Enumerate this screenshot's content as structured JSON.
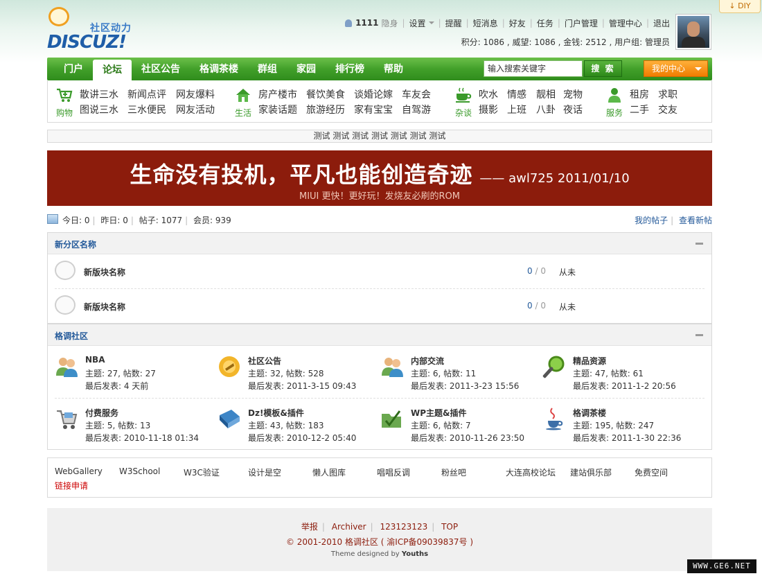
{
  "diy_label": "↓ DIY",
  "logo": {
    "sub": "社区动力",
    "main": "DISCUZ!"
  },
  "user": {
    "name": "1111",
    "status": "隐身",
    "settings": "设置",
    "links": [
      "提醒",
      "短消息",
      "好友",
      "任务",
      "门户管理",
      "管理中心",
      "退出"
    ],
    "credits": "积分: 1086 , 威望: 1086 , 金钱: 2512 , 用户组: 管理员"
  },
  "nav": {
    "items": [
      "门户",
      "论坛",
      "社区公告",
      "格调茶楼",
      "群组",
      "家园",
      "排行榜",
      "帮助"
    ],
    "search_value": "输入搜索关键字",
    "search_button": "搜 索",
    "my_center": "我的中心"
  },
  "subnav": {
    "groups": [
      {
        "icon": "shopping-cart-icon",
        "label": "购物",
        "links": [
          "散讲三水",
          "新闻点评",
          "网友爆料",
          "图说三水",
          "三水便民",
          "网友活动"
        ]
      },
      {
        "icon": "house-icon",
        "label": "生活",
        "links": [
          "房产楼市",
          "餐饮美食",
          "谈婚论嫁",
          "车友会",
          "家装话题",
          "旅游经历",
          "家有宝宝",
          "自驾游"
        ]
      },
      {
        "icon": "tea-cup-icon",
        "label": "杂谈",
        "links": [
          "吹水",
          "情感",
          "靓相",
          "宠物",
          "摄影",
          "上班",
          "八卦",
          "夜话"
        ]
      },
      {
        "icon": "person-icon",
        "label": "服务",
        "links": [
          "租房",
          "求职",
          "二手",
          "交友"
        ]
      }
    ]
  },
  "announce": "测试 测试 测试 测试 测试 测试 测试",
  "banner": {
    "main": "生命没有投机，平凡也能创造奇迹",
    "author": "—— awl725   2011/01/10",
    "sub": "MIUI 更快！更好玩！发烧友必刷的ROM"
  },
  "stats": {
    "today": "今日: 0",
    "yesterday": "昨日: 0",
    "posts": "帖子: 1077",
    "members": "会员: 939",
    "my_posts": "我的帖子",
    "new_posts": "查看新帖"
  },
  "cat1": {
    "title": "新分区名称",
    "forums": [
      {
        "name": "新版块名称",
        "threads": "0",
        "posts": "0",
        "last": "从未"
      },
      {
        "name": "新版块名称",
        "threads": "0",
        "posts": "0",
        "last": "从未"
      }
    ]
  },
  "cat2": {
    "title": "格调社区",
    "forums": [
      {
        "name": "NBA",
        "stats": "主题: 27, 帖数: 27",
        "last": "最后发表: 4 天前",
        "icon": "users-icon"
      },
      {
        "name": "社区公告",
        "stats": "主题: 32, 帖数: 528",
        "last": "最后发表: 2011-3-15 09:43",
        "icon": "megaphone-icon"
      },
      {
        "name": "内部交流",
        "stats": "主题: 6, 帖数: 11",
        "last": "最后发表: 2011-3-23 15:56",
        "icon": "users-icon"
      },
      {
        "name": "精品资源",
        "stats": "主题: 47, 帖数: 61",
        "last": "最后发表: 2011-1-2 20:56",
        "icon": "magnifier-icon"
      },
      {
        "name": "付费服务",
        "stats": "主题: 5, 帖数: 13",
        "last": "最后发表: 2010-11-18 01:34",
        "icon": "cart-icon"
      },
      {
        "name": "Dz!模板&插件",
        "stats": "主题: 43, 帖数: 183",
        "last": "最后发表: 2010-12-2 05:40",
        "icon": "book-icon"
      },
      {
        "name": "WP主题&插件",
        "stats": "主题: 6, 帖数: 7",
        "last": "最后发表: 2010-11-26 23:50",
        "icon": "folder-icon"
      },
      {
        "name": "格调茶楼",
        "stats": "主题: 195, 帖数: 247",
        "last": "最后发表: 2011-1-30 22:36",
        "icon": "java-cup-icon"
      }
    ]
  },
  "friend_links": {
    "items": [
      "WebGallery",
      "W3School",
      "W3C验证",
      "设计是空",
      "懒人图库",
      "唱唱反调",
      "粉丝吧",
      "大连高校论坛",
      "建站俱乐部",
      "免费空间"
    ],
    "apply": "链接申请"
  },
  "footer": {
    "links": [
      "举报",
      "Archiver",
      "123123123",
      "TOP"
    ],
    "copy": "© 2001-2010 格调社区 ( 渝ICP备09039837号 )",
    "theme_prefix": "Theme designed by",
    "theme_author": "Youths"
  },
  "watermark": "WWW.GE6.NET"
}
